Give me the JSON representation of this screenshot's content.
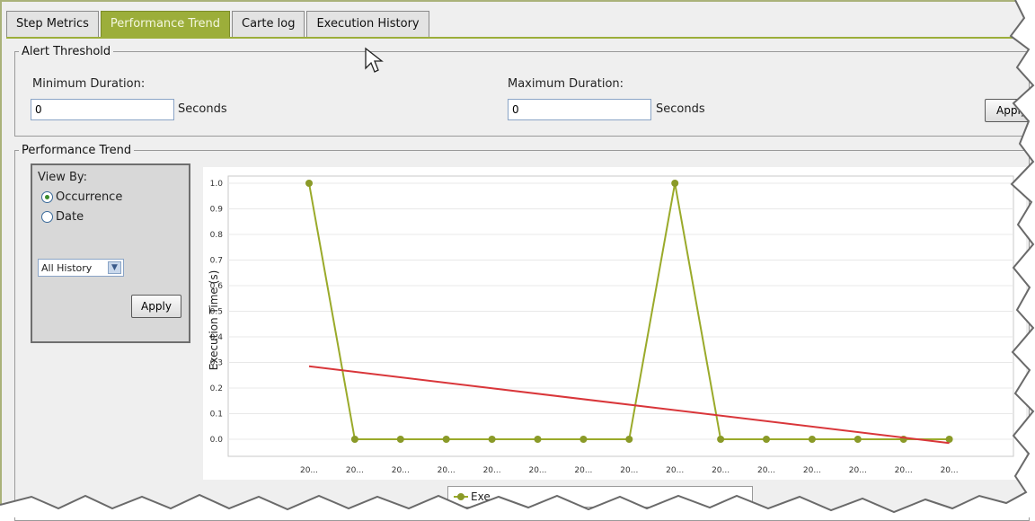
{
  "tabs": [
    {
      "label": "Step Metrics",
      "active": false
    },
    {
      "label": "Performance Trend",
      "active": true
    },
    {
      "label": "Carte log",
      "active": false
    },
    {
      "label": "Execution History",
      "active": false
    }
  ],
  "alert_threshold": {
    "legend": "Alert Threshold",
    "min_label": "Minimum Duration:",
    "min_value": "0",
    "min_unit": "Seconds",
    "max_label": "Maximum Duration:",
    "max_value": "0",
    "max_unit": "Seconds",
    "apply_label": "Apply"
  },
  "performance_trend": {
    "legend": "Performance Trend",
    "view_by_label": "View By:",
    "options": [
      {
        "label": "Occurrence",
        "checked": true
      },
      {
        "label": "Date",
        "checked": false
      }
    ],
    "history_select": "All History",
    "apply_label": "Apply"
  },
  "chart_data": {
    "type": "line",
    "ylabel": "Execution Time (s)",
    "ylim": [
      0,
      1.0
    ],
    "yticks": [
      "1.0",
      "0.9",
      "0.8",
      "0.7",
      "0.6",
      "0.5",
      "0.4",
      "0.3",
      "0.2",
      "0.1",
      "0.0"
    ],
    "categories": [
      "20...",
      "20...",
      "20...",
      "20...",
      "20...",
      "20...",
      "20...",
      "20...",
      "20...",
      "20...",
      "20...",
      "20...",
      "20...",
      "20...",
      "20..."
    ],
    "series": [
      {
        "values": [
          1.0,
          0.0,
          0.0,
          0.0,
          0.0,
          0.0,
          0.0,
          0.0,
          1.0,
          0.0,
          0.0,
          0.0,
          0.0,
          0.0,
          0.0
        ],
        "color": "#9aaa2a"
      },
      {
        "values": [
          0.285,
          -0.015
        ],
        "color": "#d9363a",
        "kind": "trend"
      }
    ],
    "grid": true,
    "legend_text": "Exe"
  },
  "colors": {
    "accent": "#9cae3a",
    "series": "#9aaa2a",
    "trend": "#d9363a"
  }
}
